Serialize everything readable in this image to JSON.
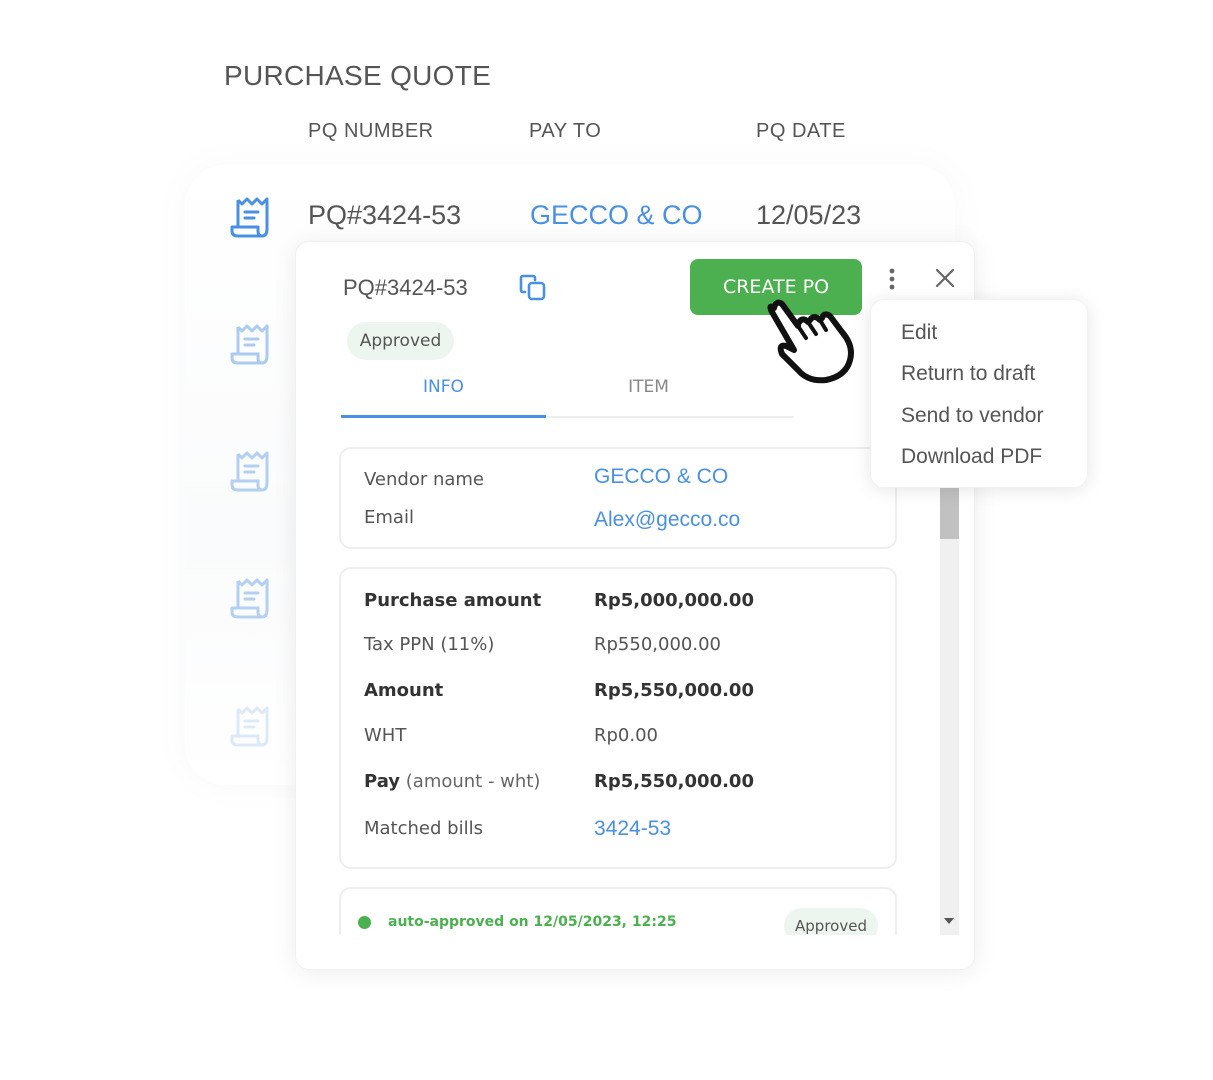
{
  "page": {
    "title": "PURCHASE QUOTE",
    "columns": [
      "PQ NUMBER",
      "PAY TO",
      "PQ DATE"
    ]
  },
  "list": {
    "rows": [
      {
        "number": "PQ#3424-53",
        "pay_to": "GECCO & CO",
        "date": "12/05/23",
        "icon": "receipt-icon"
      }
    ],
    "faded_row_icons": [
      "receipt-icon",
      "receipt-icon",
      "receipt-icon",
      "receipt-icon"
    ]
  },
  "panel": {
    "pq_number": "PQ#3424-53",
    "copy_icon": "copy-icon",
    "create_button": "CREATE PO",
    "more_icon": "more-vertical-icon",
    "close_icon": "close-icon",
    "status": "Approved",
    "tabs": [
      {
        "label": "INFO",
        "active": true
      },
      {
        "label": "ITEM",
        "active": false
      }
    ],
    "vendor": {
      "name_label": "Vendor name",
      "name_value": "GECCO & CO",
      "email_label": "Email",
      "email_value": "Alex@gecco.co"
    },
    "amounts": {
      "purchase_amount_label": "Purchase amount",
      "purchase_amount_value": "Rp5,000,000.00",
      "tax_label": "Tax PPN (11%)",
      "tax_value": "Rp550,000.00",
      "amount_label": "Amount",
      "amount_value": "Rp5,550,000.00",
      "wht_label": "WHT",
      "wht_value": "Rp0.00",
      "pay_label": "Pay",
      "pay_label_suffix": " (amount - wht)",
      "pay_value": "Rp5,550,000.00",
      "matched_bills_label": "Matched bills",
      "matched_bills_value": "3424-53"
    },
    "approval": {
      "text": "auto-approved on 12/05/2023, 12:25",
      "status": "Approved"
    }
  },
  "menu": {
    "items": [
      "Edit",
      "Return to draft",
      "Send to vendor",
      "Download PDF"
    ]
  },
  "colors": {
    "accent_blue": "#4a90e2",
    "primary_green": "#4caf50",
    "approved_pill_bg": "#edf6ee"
  }
}
